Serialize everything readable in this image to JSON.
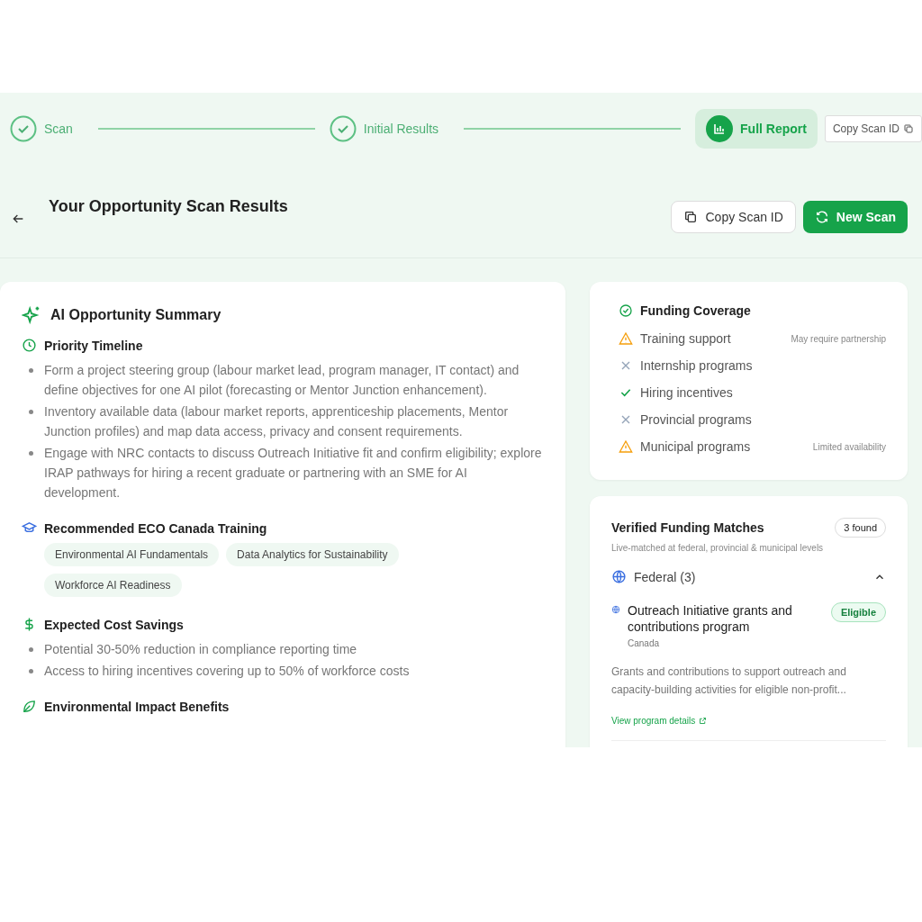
{
  "steps": [
    {
      "label": "Scan",
      "selected": false
    },
    {
      "label": "Initial Results",
      "selected": false
    },
    {
      "label": "Full Report",
      "selected": true
    }
  ],
  "step_copy_button": "Copy Scan ID",
  "header": {
    "title": "Your Opportunity Scan Results",
    "copy_button": "Copy Scan ID",
    "new_scan_button": "New Scan"
  },
  "summary": {
    "title": "AI Opportunity Summary",
    "sections": [
      {
        "kind": "timeline",
        "title": "Priority Timeline",
        "bullets": [
          "Form a project steering group (labour market lead, program manager, IT contact) and define objectives for one AI pilot (forecasting or Mentor Junction enhancement).",
          "Inventory available data (labour market reports, apprenticeship placements, Mentor Junction profiles) and map data access, privacy and consent requirements.",
          "Engage with NRC contacts to discuss Outreach Initiative fit and confirm eligibility; explore IRAP pathways for hiring a recent graduate or partnering with an SME for AI development."
        ]
      },
      {
        "kind": "training",
        "title": "Recommended ECO Canada Training",
        "tags": [
          "Environmental AI Fundamentals",
          "Data Analytics for Sustainability",
          "Workforce AI Readiness"
        ]
      },
      {
        "kind": "savings",
        "title": "Expected Cost Savings",
        "bullets": [
          "Potential 30-50% reduction in compliance reporting time",
          "Access to hiring incentives covering up to 50% of workforce costs"
        ]
      },
      {
        "kind": "environment",
        "title": "Environmental Impact Benefits"
      }
    ]
  },
  "coverage": {
    "title": "Funding Coverage",
    "items": [
      {
        "label": "Training support",
        "kind": "warning",
        "note": "May require partnership"
      },
      {
        "label": "Internship programs",
        "kind": "cross"
      },
      {
        "label": "Hiring incentives",
        "kind": "check"
      },
      {
        "label": "Provincial programs",
        "kind": "cross"
      },
      {
        "label": "Municipal programs",
        "kind": "warning",
        "note": "Limited availability"
      }
    ]
  },
  "matches": {
    "title": "Verified Funding Matches",
    "count": "3 found",
    "subtitle": "Live-matched at federal, provincial & municipal levels",
    "groups": [
      {
        "label": "Federal (3)",
        "expanded": true,
        "programs": [
          {
            "name": "Outreach Initiative grants and contributions program",
            "badge": "Eligible",
            "region": "Canada",
            "description": "Grants and contributions to support outreach and capacity-building activities for eligible non-profit...",
            "link": "View program details"
          }
        ]
      }
    ]
  }
}
